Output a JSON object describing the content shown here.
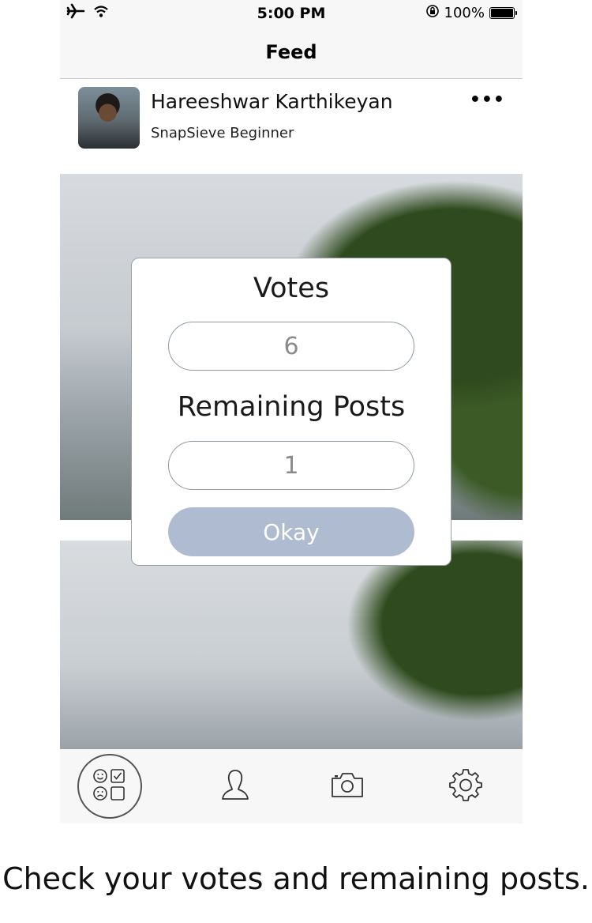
{
  "status_bar": {
    "time": "5:00 PM",
    "battery_percent": "100%",
    "icons": [
      "airplane-icon",
      "wifi-icon",
      "orientation-lock-icon",
      "battery-icon"
    ]
  },
  "nav": {
    "title": "Feed"
  },
  "post": {
    "user_name": "Hareeshwar Karthikeyan",
    "user_level": "SnapSieve Beginner",
    "more": "•••"
  },
  "modal": {
    "votes_label": "Votes",
    "votes_value": "6",
    "remaining_label": "Remaining Posts",
    "remaining_value": "1",
    "okay_label": "Okay"
  },
  "tab_bar": {
    "items": [
      {
        "icon": "feed-icon",
        "selected": true
      },
      {
        "icon": "profile-icon",
        "selected": false
      },
      {
        "icon": "camera-icon",
        "selected": false
      },
      {
        "icon": "settings-icon",
        "selected": false
      }
    ]
  },
  "caption": "Check your votes and remaining posts.",
  "colors": {
    "button_bg": "#aebbd0",
    "field_border": "#8f9aa3",
    "bar_bg": "#f7f7f7"
  }
}
